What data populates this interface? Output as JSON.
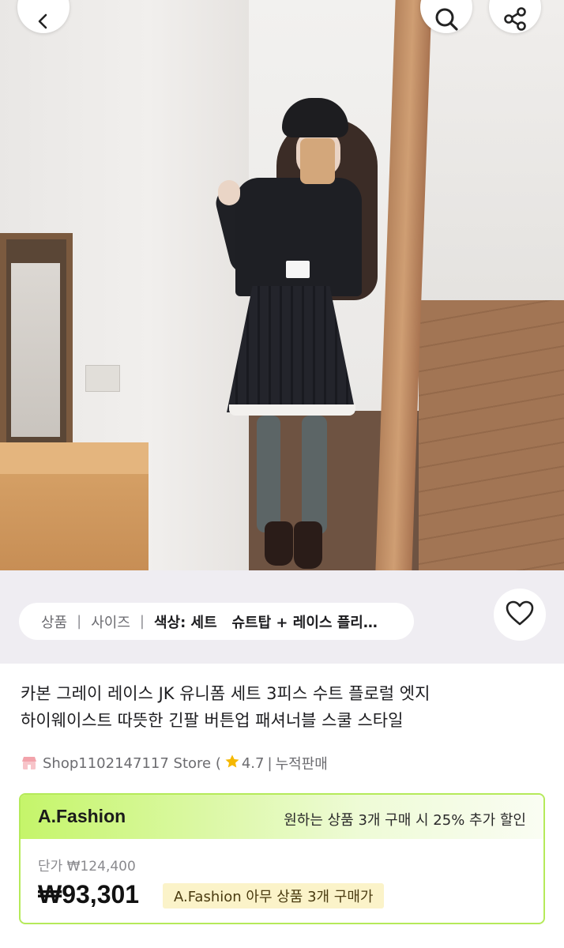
{
  "header": {
    "back_icon": "chevron-left-icon",
    "search_icon": "search-icon",
    "share_icon": "share-icon"
  },
  "options_bar": {
    "items": [
      "상품",
      "사이즈"
    ],
    "separator": "|",
    "selected_label": "색상: 세트   슈트탑 + 레이스 플리…"
  },
  "product": {
    "title_line1": "카본 그레이 레이스 JK 유니폼 세트 3피스 수트 플로럴 엣지",
    "title_line2": "하이웨이스트 따뜻한 긴팔 버튼업 패셔너블 스쿨 스타일"
  },
  "store": {
    "name": "Shop1102147117 Store (",
    "rating": "4.7",
    "divider": "|",
    "sales_label": "누적판매",
    "star_color": "#f5b800"
  },
  "deal_card": {
    "brand": "A.Fashion",
    "promo_text": "원하는 상품 3개 구매 시 25% 추가 할인",
    "unit_price_label": "단가 ₩124,400",
    "sale_price": "₩93,301",
    "tag": "A.Fashion 아무 상품 3개 구매가",
    "accent": "#b5ea5a"
  }
}
